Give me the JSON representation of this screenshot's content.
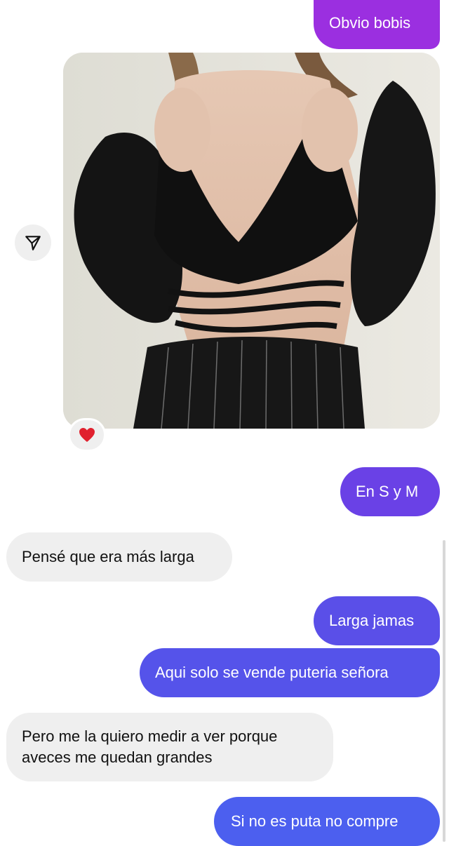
{
  "messages": [
    {
      "id": "m1",
      "direction": "sent",
      "text": "Obvio bobis",
      "color": "#9b2fe0"
    },
    {
      "id": "m2",
      "direction": "sent",
      "type": "photo",
      "content": "black satin wrap crop top with puff sleeves and pinstripe trousers",
      "reaction": "heart"
    },
    {
      "id": "m3",
      "direction": "sent",
      "text": "En S y M",
      "color": "#6a41e6"
    },
    {
      "id": "m4",
      "direction": "received",
      "text": "Pensé que era más larga"
    },
    {
      "id": "m5",
      "direction": "sent",
      "text": "Larga jamas",
      "color": "#5a4fe8"
    },
    {
      "id": "m6",
      "direction": "sent",
      "text": "Aqui solo se vende puteria señora",
      "color": "#5553ea"
    },
    {
      "id": "m7",
      "direction": "received",
      "text_lines": [
        "Pero me la quiero medir a ver porque",
        "aveces me quedan grandes"
      ]
    },
    {
      "id": "m8",
      "direction": "sent",
      "text": "Si no es puta no compre",
      "color": "#4c5fef"
    }
  ],
  "icons": {
    "share": "send-share-icon",
    "reaction": "heart-reaction-icon"
  },
  "colors": {
    "received_bubble": "#efefef",
    "background": "#ffffff"
  }
}
